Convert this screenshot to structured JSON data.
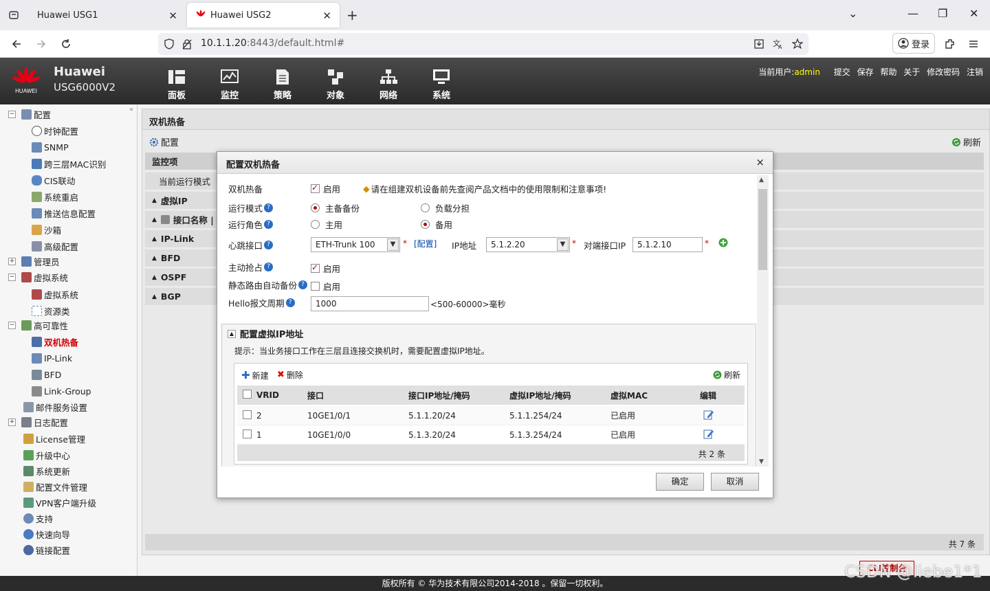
{
  "browser": {
    "tabs": [
      {
        "label": "Huawei USG1"
      },
      {
        "label": "Huawei USG2"
      }
    ],
    "url_host": "10.1.1.20",
    "url_rest": ":8443/default.html#",
    "login_label": "登录"
  },
  "header": {
    "brand": "Huawei",
    "model": "USG6000V2",
    "logo_text": "HUAWEI",
    "menu": [
      "面板",
      "监控",
      "策略",
      "对象",
      "网络",
      "系统"
    ],
    "user_label": "当前用户:",
    "user": "admin",
    "links": [
      "提交",
      "保存",
      "帮助",
      "关于",
      "修改密码",
      "注销"
    ]
  },
  "sidebar": {
    "items": [
      {
        "label": "配置"
      },
      {
        "label": "时钟配置"
      },
      {
        "label": "SNMP"
      },
      {
        "label": "跨三层MAC识别"
      },
      {
        "label": "CIS联动"
      },
      {
        "label": "系统重启"
      },
      {
        "label": "推送信息配置"
      },
      {
        "label": "沙箱"
      },
      {
        "label": "高级配置"
      },
      {
        "label": "管理员"
      },
      {
        "label": "虚拟系统"
      },
      {
        "label": "虚拟系统"
      },
      {
        "label": "资源类"
      },
      {
        "label": "高可靠性"
      },
      {
        "label": "双机热备"
      },
      {
        "label": "IP-Link"
      },
      {
        "label": "BFD"
      },
      {
        "label": "Link-Group"
      },
      {
        "label": "邮件服务设置"
      },
      {
        "label": "日志配置"
      },
      {
        "label": "License管理"
      },
      {
        "label": "升级中心"
      },
      {
        "label": "系统更新"
      },
      {
        "label": "配置文件管理"
      },
      {
        "label": "VPN客户端升级"
      },
      {
        "label": "支持"
      },
      {
        "label": "快速向导"
      },
      {
        "label": "链接配置"
      }
    ]
  },
  "main": {
    "title": "双机热备",
    "config_label": "配置",
    "refresh_label": "刷新",
    "monitor_header": "监控项",
    "current_mode_label": "当前运行模式",
    "sections": [
      "虚拟IP",
      "接口名称 | V",
      "IP-Link",
      "BFD",
      "OSPF",
      "BGP"
    ],
    "footer_count": "共 7 条"
  },
  "modal": {
    "title": "配置双机热备",
    "close": "×",
    "hot_standby_label": "双机热备",
    "enable_label": "启用",
    "warning": "请在组建双机设备前先查阅产品文档中的使用限制和注意事项!",
    "run_mode_label": "运行模式",
    "run_mode_options": [
      "主备备份",
      "负载分担"
    ],
    "role_label": "运行角色",
    "role_options": [
      "主用",
      "备用"
    ],
    "heartbeat_label": "心跳接口",
    "heartbeat_value": "ETH-Trunk 100",
    "config_link": "[配置]",
    "ip_label": "IP地址",
    "ip_value": "5.1.2.20",
    "peer_label": "对端接口IP",
    "peer_value": "5.1.2.10",
    "preempt_label": "主动抢占",
    "static_route_label": "静态路由自动备份",
    "hello_label": "Hello报文周期",
    "hello_value": "1000",
    "hello_hint": "<500-60000>毫秒",
    "vip_title": "配置虚拟IP地址",
    "vip_hint": "提示：当业务接口工作在三层且连接交换机时，需要配置虚拟IP地址。",
    "new_label": "新建",
    "delete_label": "删除",
    "refresh_label": "刷新",
    "columns": [
      "VRID",
      "接口",
      "接口IP地址/掩码",
      "虚拟IP地址/掩码",
      "虚拟MAC",
      "编辑"
    ],
    "rows": [
      {
        "vrid": "2",
        "iface": "10GE1/0/1",
        "iface_ip": "5.1.1.20/24",
        "vip": "5.1.1.254/24",
        "mac": "已启用"
      },
      {
        "vrid": "1",
        "iface": "10GE1/0/0",
        "iface_ip": "5.1.3.20/24",
        "vip": "5.1.3.254/24",
        "mac": "已启用"
      }
    ],
    "grid_count": "共 2 条",
    "ok_label": "确定",
    "cancel_label": "取消"
  },
  "footer": {
    "copyright": "版权所有 © 华为技术有限公司2014-2018 。保留一切权利。",
    "cli_label": "CLI控制台",
    "watermark": "CSDN @liebe1*1"
  },
  "colors": {
    "accent_red": "#c00000",
    "header_dark": "#2a2a2a",
    "link_blue": "#0645ad"
  }
}
